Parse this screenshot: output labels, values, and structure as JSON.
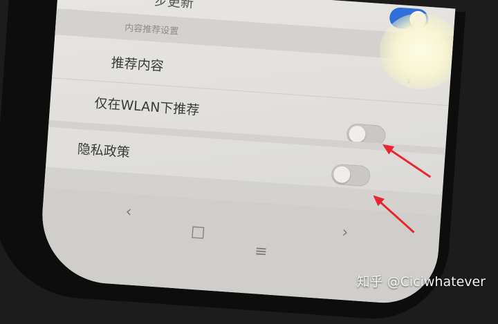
{
  "settings": {
    "top_item_label": "步更新",
    "top_item_toggle": "on",
    "section_title": "内容推荐设置",
    "recommend_label": "推荐内容",
    "recommend_chevron": "›",
    "wlan_label": "仅在WLAN下推荐",
    "wlan_toggle": "off",
    "privacy_label": "隐私政策",
    "privacy_toggle": "off"
  },
  "navbar": {
    "back_glyph": "‹",
    "home_glyph": "□",
    "menu_glyph": "≡",
    "forward_glyph": "›"
  },
  "annotations": {
    "arrow_color": "#e8262b",
    "arrow_count": 2
  },
  "watermark": "知乎 @Ciciwhatever",
  "colors": {
    "accent_toggle_on": "#2e6fd8",
    "screen_bg": "#e8e6e2"
  }
}
